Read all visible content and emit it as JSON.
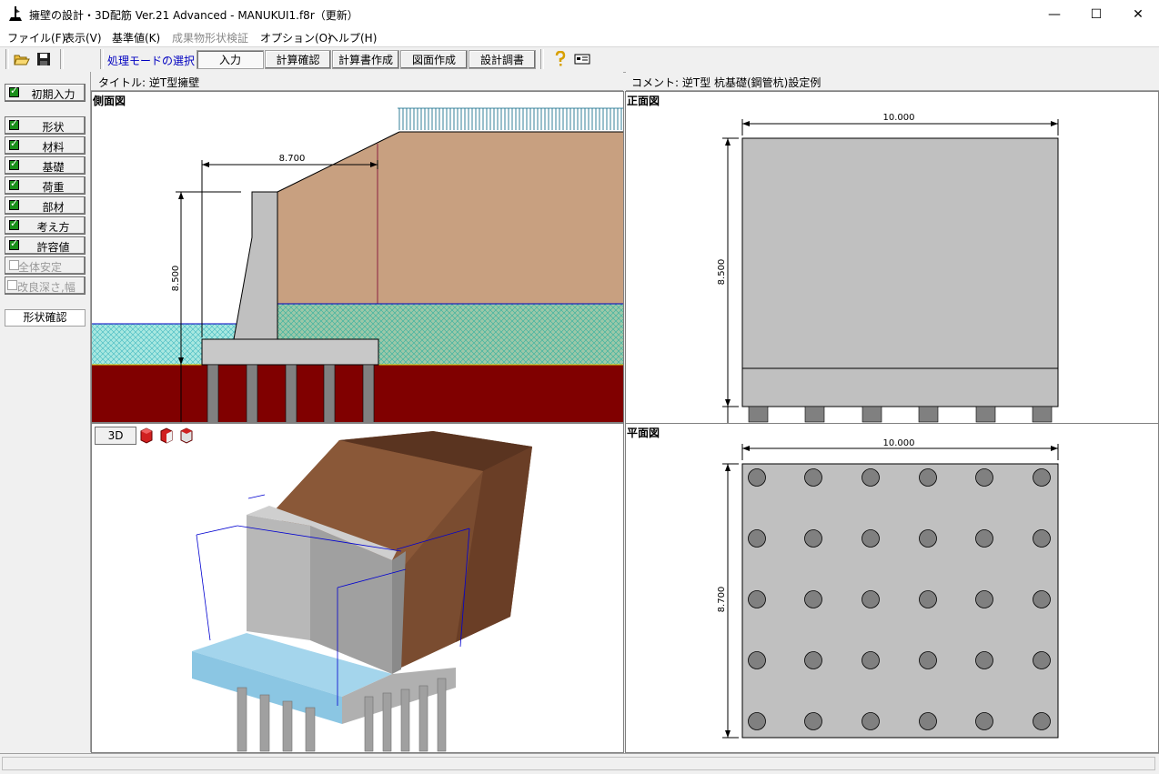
{
  "window": {
    "title": "擁壁の設計・3D配筋 Ver.21 Advanced  - MANUKUI1.f8r（更新）",
    "minimize": "—",
    "maximize": "☐",
    "close": "✕"
  },
  "menu": [
    "ファイル(F)",
    "表示(V)",
    "基準値(K)",
    "成果物形状検証",
    "オプション(O)",
    "ヘルプ(H)"
  ],
  "toolbar": {
    "mode_label": "処理モードの選択",
    "modes": [
      "入力",
      "計算確認",
      "計算書作成",
      "図面作成",
      "設計調書"
    ],
    "active_mode": "入力"
  },
  "sidebar": {
    "initial": "初期入力",
    "items": [
      {
        "label": "形状",
        "checked": true
      },
      {
        "label": "材料",
        "checked": true
      },
      {
        "label": "基礎",
        "checked": true
      },
      {
        "label": "荷重",
        "checked": true
      },
      {
        "label": "部材",
        "checked": true
      },
      {
        "label": "考え方",
        "checked": true
      },
      {
        "label": "許容値",
        "checked": true
      },
      {
        "label": "全体安定",
        "checked": false
      },
      {
        "label": "改良深さ,幅",
        "checked": false
      }
    ],
    "shape_check": "形状確認"
  },
  "header": {
    "title": "タイトル:  逆T型擁壁",
    "comment": "コメント:  逆T型  杭基礎(鋼管杭)設定例"
  },
  "panes": {
    "side": {
      "title": "側面図",
      "dim_width": "8.700",
      "dim_height": "8.500"
    },
    "front": {
      "title": "正面図",
      "dim_width": "10.000",
      "dim_height": "8.500"
    },
    "plan": {
      "title": "平面図",
      "dim_width": "10.000",
      "dim_height": "8.700"
    },
    "view3d": {
      "button": "3D"
    }
  },
  "colors": {
    "soil": "#c8a080",
    "ground": "#800000",
    "water": "#a0e8e0",
    "concrete": "#c0c0c0"
  }
}
